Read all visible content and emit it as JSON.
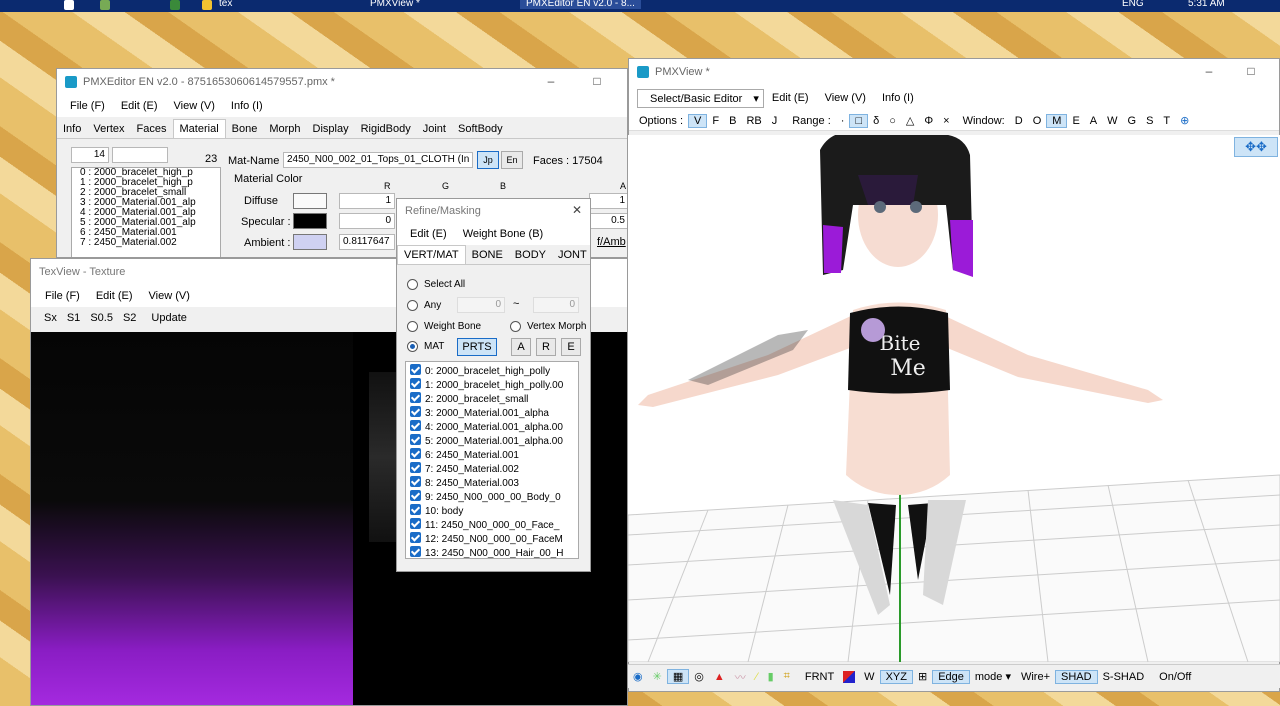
{
  "taskbar": {
    "items": [
      "tex",
      "PMXView *",
      "PMXEditor EN v2.0 - 8..."
    ],
    "lang": "ENG",
    "time": "5:31 AM"
  },
  "editor": {
    "title": "PMXEditor EN v2.0 - 8751653060614579557.pmx *",
    "menu": [
      "File (F)",
      "Edit (E)",
      "View (V)",
      "Info (I)"
    ],
    "tabs": [
      "Info",
      "Vertex",
      "Faces",
      "Material",
      "Bone",
      "Morph",
      "Display",
      "RigidBody",
      "Joint",
      "SoftBody"
    ],
    "index": "14",
    "count": "23",
    "mat_name_label": "Mat-Name :",
    "mat_name": "2450_N00_002_01_Tops_01_CLOTH (In",
    "jp": "Jp",
    "en": "En",
    "faces_label": "Faces : 17504",
    "material_color": "Material Color",
    "cols": [
      "R",
      "G",
      "B",
      "A"
    ],
    "diffuse": "Diffuse",
    "specular": "Specular :",
    "ambient": "Ambient :",
    "diffuse_r": "1",
    "specular_r": "0",
    "ambient_r": "0.8117647",
    "diffuse_a": "1",
    "specular_a": "0.5",
    "link_text": "f/Amb",
    "materials": [
      "0 : 2000_bracelet_high_p",
      "1 : 2000_bracelet_high_p",
      "2 : 2000_bracelet_small",
      "3 : 2000_Material.001_alp",
      "4 : 2000_Material.001_alp",
      "5 : 2000_Material.001_alp",
      "6 : 2450_Material.001",
      "7 : 2450_Material.002"
    ]
  },
  "texview": {
    "title": "TexView - Texture",
    "menu": [
      "File (F)",
      "Edit (E)",
      "View (V)"
    ],
    "tools": [
      "Sx",
      "S1",
      "S0.5",
      "S2",
      "Update"
    ]
  },
  "refine": {
    "title": "Refine/Masking",
    "menu": [
      "Edit (E)",
      "Weight Bone (B)"
    ],
    "tabs": [
      "VERT/MAT",
      "BONE",
      "BODY",
      "JONT"
    ],
    "select_all": "Select All",
    "any": "Any",
    "any_from": "0",
    "tilde": "~",
    "any_to": "0",
    "weight_bone": "Weight Bone",
    "vertex_morph": "Vertex Morph",
    "mat": "MAT",
    "prts": "PRTS",
    "btn_a": "A",
    "btn_r": "R",
    "btn_e": "E",
    "materials": [
      "0: 2000_bracelet_high_polly",
      "1: 2000_bracelet_high_polly.00",
      "2: 2000_bracelet_small",
      "3: 2000_Material.001_alpha",
      "4: 2000_Material.001_alpha.00",
      "5: 2000_Material.001_alpha.00",
      "6: 2450_Material.001",
      "7: 2450_Material.002",
      "8: 2450_Material.003",
      "9: 2450_N00_000_00_Body_0",
      "10: body",
      "11: 2450_N00_000_00_Face_",
      "12: 2450_N00_000_00_FaceM",
      "13: 2450_N00_000_Hair_00_H"
    ]
  },
  "viewer": {
    "title": "PMXView *",
    "mode": "Select/Basic Editor",
    "menu": [
      "Edit (E)",
      "View (V)",
      "Info (I)"
    ],
    "options_label": "Options :",
    "options": [
      "V",
      "F",
      "B",
      "RB",
      "J"
    ],
    "range_label": "Range :",
    "range": [
      "·",
      "□",
      "δ",
      "○",
      "△",
      "Φ",
      "×"
    ],
    "window_label": "Window:",
    "window": [
      "D",
      "O",
      "M",
      "E",
      "A",
      "W",
      "G",
      "S",
      "T"
    ],
    "shirt_text_1": "Bite",
    "shirt_text_2": "Me",
    "bottom": [
      "FRNT",
      "W",
      "XYZ",
      "Edge",
      "mode ▾",
      "Wire+",
      "SHAD",
      "S-SHAD",
      "On/Off"
    ]
  },
  "colors": {
    "accent": "#1a6cc7",
    "purple": "#9b1bd8",
    "taskbar": "#0b2a6f"
  }
}
